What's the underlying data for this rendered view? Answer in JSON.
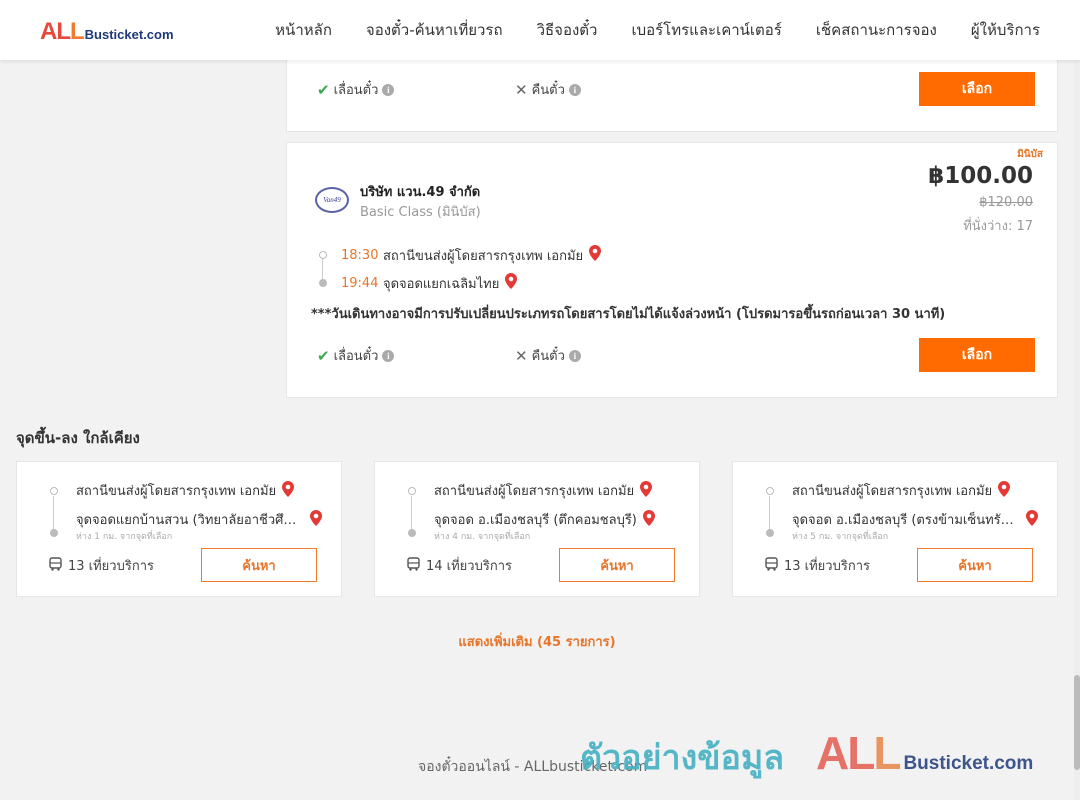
{
  "header": {
    "logo_big_1": "AL",
    "logo_big_2": "L",
    "logo_small": "Busticket.com",
    "nav": [
      "หน้าหลัก",
      "จองตั๋ว-ค้นหาเที่ยวรถ",
      "วิธีจองตั๋ว",
      "เบอร์โทรและเคาน์เตอร์",
      "เช็คสถานะการจอง",
      "ผู้ให้บริการ"
    ]
  },
  "card_top": {
    "feature_change": "เลื่อนตั๋ว",
    "feature_refund": "คืนตั๋ว",
    "select_label": "เลือก"
  },
  "card_main": {
    "badge": "มินิบัส",
    "operator_logo_text": "Van49",
    "operator_name": "บริษัท แวน.49 จำกัด",
    "operator_class": "Basic Class (มินิบัส)",
    "price": "฿100.00",
    "old_price": "฿120.00",
    "seats": "ที่นั่งว่าง: 17",
    "depart_time": "18:30",
    "depart_place": "สถานีขนส่งผู้โดยสารกรุงเทพ เอกมัย",
    "arrive_time": "19:44",
    "arrive_place": "จุดจอดแยกเฉลิมไทย",
    "notice": "***วันเดินทางอาจมีการปรับเปลี่ยนประเภทรถโดยสารโดยไม่ได้แจ้งล่วงหน้า (โปรดมารอขึ้นรถก่อนเวลา 30 นาที)",
    "feature_change": "เลื่อนตั๋ว",
    "feature_refund": "คืนตั๋ว",
    "select_label": "เลือก"
  },
  "nearby": {
    "title": "จุดขึ้น-ลง ใกล้เคียง",
    "items": [
      {
        "from": "สถานีขนส่งผู้โดยสารกรุงเทพ เอกมัย",
        "to": "จุดจอดแยกบ้านสวน (วิทยาลัยอาชีวศึกษาชลบุรี)",
        "distance": "ห่าง 1 กม. จากจุดที่เลือก",
        "trips": "13 เที่ยวบริการ",
        "button": "ค้นหา"
      },
      {
        "from": "สถานีขนส่งผู้โดยสารกรุงเทพ เอกมัย",
        "to": "จุดจอด อ.เมืองชลบุรี (ตึกคอมชลบุรี)",
        "distance": "ห่าง 4 กม. จากจุดที่เลือก",
        "trips": "14 เที่ยวบริการ",
        "button": "ค้นหา"
      },
      {
        "from": "สถานีขนส่งผู้โดยสารกรุงเทพ เอกมัย",
        "to": "จุดจอด อ.เมืองชลบุรี (ตรงข้ามเซ็นทรัลชลบุรี)",
        "distance": "ห่าง 5 กม. จากจุดที่เลือก",
        "trips": "13 เที่ยวบริการ",
        "button": "ค้นหา"
      }
    ],
    "show_more": "แสดงเพิ่มเติม (45 รายการ)"
  },
  "footer": {
    "text": "จองตั๋วออนไลน์ - ALLbusticket.com"
  },
  "watermark": {
    "thai": "ตัวอย่างข้อมูล",
    "logo_big_1": "AL",
    "logo_big_2": "L",
    "logo_small": "Busticket.com"
  },
  "colors": {
    "accent": "#ff6b00",
    "accent_text": "#e8752a",
    "pin": "#e53935",
    "check": "#3aa84c"
  }
}
